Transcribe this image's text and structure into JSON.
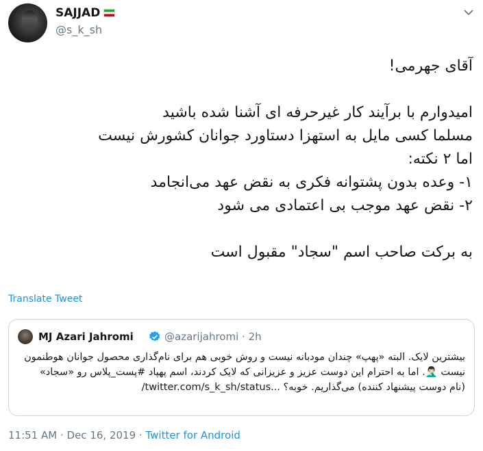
{
  "author": {
    "display_name": "SAJJAD",
    "flag": "iran-flag",
    "handle": "@s_k_sh"
  },
  "icons": {
    "more": "chevron-down-icon",
    "verified": "verified-badge-icon"
  },
  "tweet_lines": [
    "آقای جهرمی!",
    "",
    "امیدوارم با برآیند کار غیرحرفه ای آشنا شده باشید",
    "مسلما کسی مایل به استهزا دستاورد جوانان کشورش نیست",
    "اما ۲ نکته:",
    "۱- وعده بدون پشتوانه فکری به نقض عهد می‌انجامد",
    "۲- نقض عهد موجب بی اعتمادی می شود",
    "",
    "به برکت صاحب اسم \"سجاد\" مقبول است"
  ],
  "translate_label": "Translate Tweet",
  "quoted": {
    "name": "MJ Azari Jahromi",
    "handle": "@azarijahromi",
    "time": "2h",
    "lines": [
      "بیشترین لایک. البته «پهپ» چندان مودبانه نیست و روش خوبی هم برای نام‌گذاری محصول جوانان هوطنمون",
      "نیست 🤦🏻‍♂️. اما به احترام این دوست عزیز و عزیزانی که لایک کردند، اسم پهپاد #پست_پلاس رو «سجاد»",
      "(نام دوست پیشنهاد کننده) می‌گذاریم. خوبه؟ ...twitter.com/s_k_sh/status/"
    ]
  },
  "meta": {
    "time": "11:51 AM",
    "date": "Dec 16, 2019",
    "source": "Twitter for Android"
  },
  "colors": {
    "link": "#1b95e0",
    "muted": "#657786",
    "text": "#14171a",
    "border": "#ccd6dd"
  }
}
